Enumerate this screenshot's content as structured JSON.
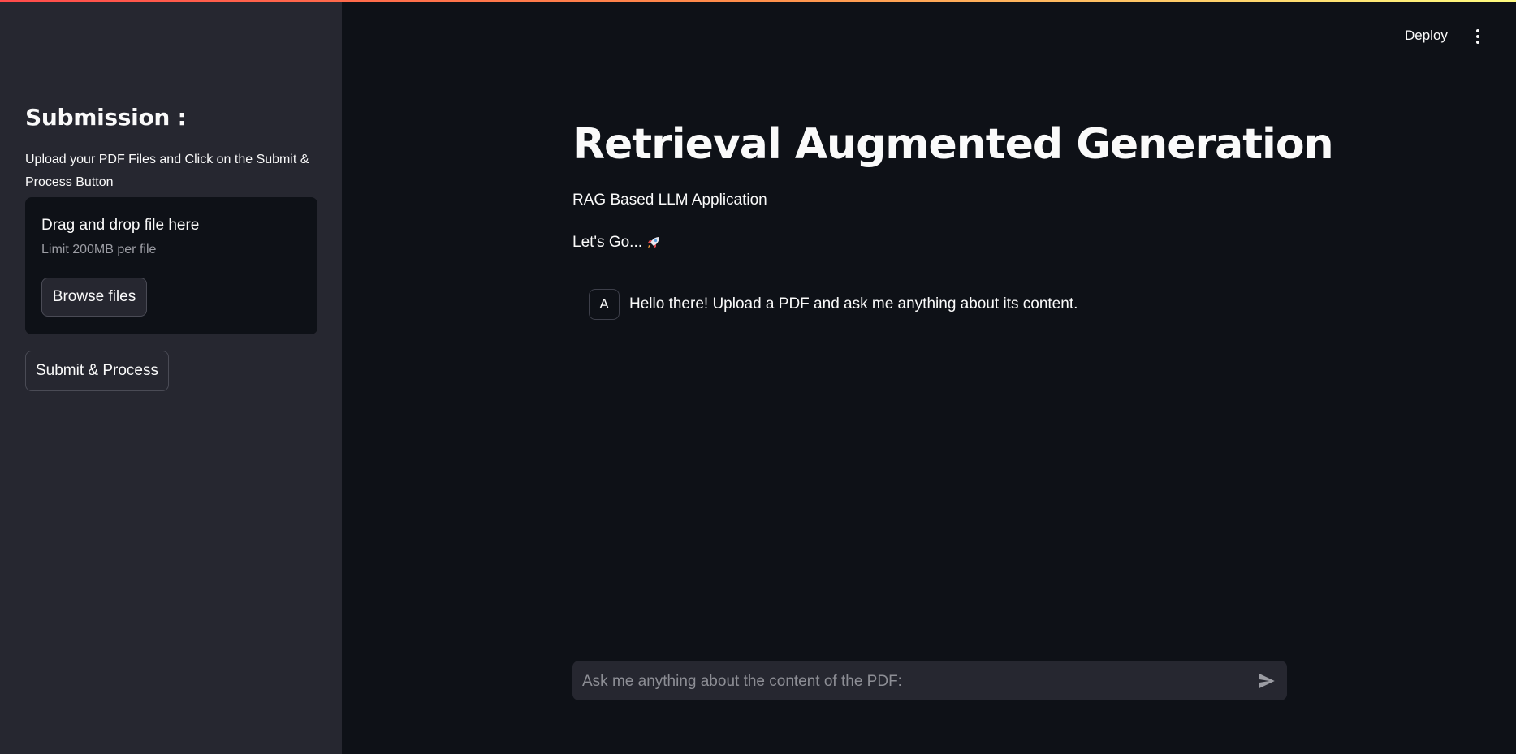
{
  "sidebar": {
    "header": "Submission :",
    "description": "Upload your PDF Files and Click on the Submit & Process Button",
    "uploader": {
      "title": "Drag and drop file here",
      "limit": "Limit 200MB per file",
      "browse_label": "Browse files"
    },
    "submit_label": "Submit & Process"
  },
  "toolbar": {
    "deploy_label": "Deploy",
    "menu_icon": "vertical-dots-icon"
  },
  "main": {
    "title": "Retrieval Augmented Generation",
    "subtitle": "RAG Based LLM Application",
    "lets_go": "Let's Go...",
    "lets_go_icon": "rocket-icon",
    "messages": [
      {
        "avatar": "A",
        "text": "Hello there! Upload a PDF and ask me anything about its content."
      }
    ]
  },
  "chat_input": {
    "placeholder": "Ask me anything about the content of the PDF:",
    "value": "",
    "send_icon": "send-icon"
  },
  "colors": {
    "background": "#0e1117",
    "sidebar": "#262730",
    "text": "#fafafa",
    "accent_gradient_start": "#ff4b4b",
    "accent_gradient_end": "#fffd80"
  }
}
